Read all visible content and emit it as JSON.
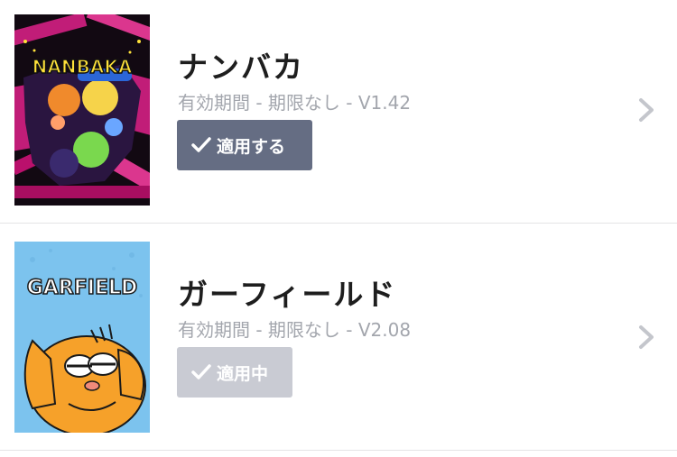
{
  "themes": [
    {
      "thumbnail_text": "NANBAKA",
      "title": "ナンバカ",
      "meta": "有効期間 - 期限なし - V1.42",
      "button_label": "適用する",
      "button_state": "apply",
      "button_color": "#656d83"
    },
    {
      "thumbnail_text": "GARFIELD",
      "title": "ガーフィールド",
      "meta": "有効期間 - 期限なし - V2.08",
      "button_label": "適用中",
      "button_state": "applied",
      "button_color": "#c9cbd3"
    }
  ],
  "colors": {
    "title": "#1e1e1e",
    "meta": "#a3a6ad",
    "chevron": "#c4c6cc",
    "divider": "#e4e4e6"
  }
}
